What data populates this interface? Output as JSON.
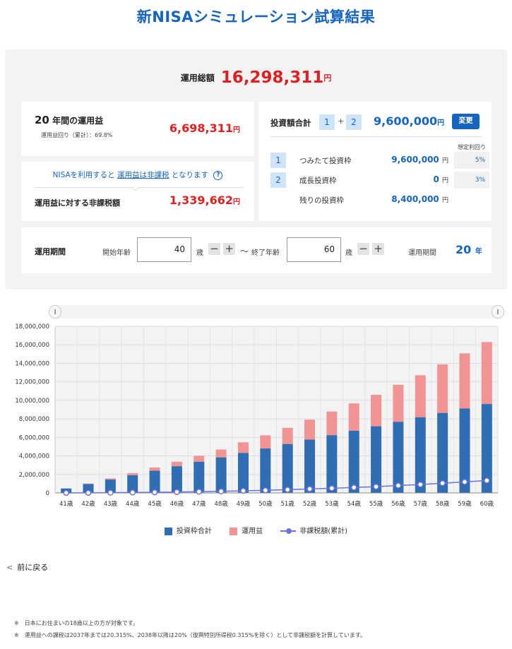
{
  "page": {
    "title": "新NISAシミュレーション試算結果"
  },
  "total": {
    "label": "運用総額",
    "value": "16,298,311",
    "unit": "円"
  },
  "profit": {
    "years": "20",
    "years_suffix": "年間の運用益",
    "sub": "運用益回り（累計）：69.8%",
    "value": "6,698,311",
    "unit": "円"
  },
  "tax": {
    "note_prefix": "NISAを利用すると",
    "note_link": "運用益は非課税",
    "note_suffix": "となります",
    "help_icon": "?",
    "label": "運用益に対する非課税額",
    "value": "1,339,662",
    "unit": "円"
  },
  "investment": {
    "title": "投資額合計",
    "badge1": "1",
    "plus": "+",
    "badge2": "2",
    "total": "9,600,000",
    "unit": "円",
    "change_label": "変更",
    "rate_header": "想定利回り",
    "rows": [
      {
        "badge": "1",
        "label": "つみたて投資枠",
        "value": "9,600,000",
        "unit": "円",
        "rate": "5%"
      },
      {
        "badge": "2",
        "label": "成長投資枠",
        "value": "0",
        "unit": "円",
        "rate": "3%"
      },
      {
        "badge": "",
        "label": "残りの投資枠",
        "value": "8,400,000",
        "unit": "円",
        "rate": ""
      }
    ]
  },
  "period": {
    "title": "運用期間",
    "start_label": "開始年齢",
    "start_value": "40",
    "age_unit": "歳",
    "minus": "−",
    "plus": "+",
    "tilde": "〜",
    "end_label": "終了年齢",
    "end_value": "60",
    "duration_label": "運用期間",
    "duration_value": "20",
    "duration_unit": "年"
  },
  "legend": {
    "invest": "投資枠合計",
    "profit": "運用益",
    "tax_free": "非課税額(累計)"
  },
  "back": {
    "label": "前に戻る"
  },
  "footnotes": [
    "※　日本にお住まいの18歳以上の方が対象です。",
    "※　運用益への課税は2037年までは20.315%、2038年以降は20%（復興特別所得税0.315%を除く）として非課税額を計算しています。"
  ],
  "colors": {
    "invest": "#2f6db5",
    "profit": "#f29494",
    "tax_free": "#6b73d8",
    "accent": "#1565c0",
    "red": "#e02020"
  },
  "chart_data": {
    "type": "bar",
    "stacked": true,
    "categories": [
      "41歳",
      "42歳",
      "43歳",
      "44歳",
      "45歳",
      "46歳",
      "47歳",
      "48歳",
      "49歳",
      "50歳",
      "51歳",
      "52歳",
      "53歳",
      "54歳",
      "55歳",
      "56歳",
      "57歳",
      "58歳",
      "59歳",
      "60歳"
    ],
    "ylim": [
      0,
      18000000
    ],
    "yticks": [
      "0",
      "2,000,000",
      "4,000,000",
      "6,000,000",
      "8,000,000",
      "10,000,000",
      "12,000,000",
      "14,000,000",
      "16,000,000",
      "18,000,000"
    ],
    "grid": true,
    "legend_position": "bottom",
    "series": [
      {
        "name": "投資枠合計",
        "kind": "bar",
        "values": [
          480000,
          960000,
          1440000,
          1920000,
          2400000,
          2880000,
          3360000,
          3840000,
          4320000,
          4800000,
          5280000,
          5760000,
          6240000,
          6720000,
          7200000,
          7680000,
          8160000,
          8640000,
          9120000,
          9600000
        ]
      },
      {
        "name": "運用益",
        "kind": "bar",
        "values": [
          10000,
          60000,
          130000,
          230000,
          350000,
          490000,
          650000,
          850000,
          1150000,
          1420000,
          1750000,
          2150000,
          2550000,
          2950000,
          3400000,
          4000000,
          4550000,
          5250000,
          5950000,
          6700000
        ]
      },
      {
        "name": "非課税額(累計)",
        "kind": "line",
        "values": [
          2000,
          12000,
          26000,
          46000,
          70000,
          98000,
          130000,
          170000,
          230000,
          284000,
          350000,
          430000,
          510000,
          590000,
          680000,
          800000,
          910000,
          1050000,
          1190000,
          1340000
        ]
      }
    ]
  }
}
